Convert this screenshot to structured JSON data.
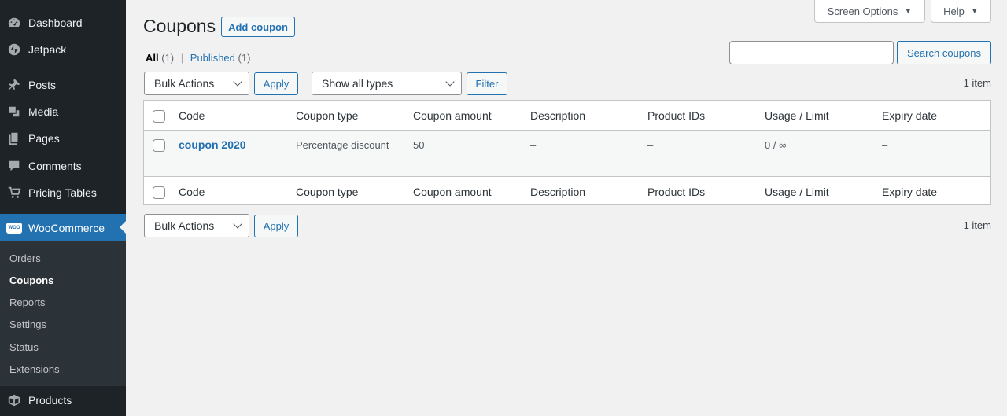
{
  "sidebar": {
    "items": [
      {
        "label": "Dashboard",
        "icon": "dashboard-icon"
      },
      {
        "label": "Jetpack",
        "icon": "jetpack-icon"
      },
      {
        "label": "Posts",
        "icon": "pin-icon"
      },
      {
        "label": "Media",
        "icon": "media-icon"
      },
      {
        "label": "Pages",
        "icon": "pages-icon"
      },
      {
        "label": "Comments",
        "icon": "comments-icon"
      },
      {
        "label": "Pricing Tables",
        "icon": "cart-icon"
      },
      {
        "label": "WooCommerce",
        "icon": "woo-icon"
      },
      {
        "label": "Products",
        "icon": "box-icon"
      }
    ],
    "woo_badge": "WOO",
    "submenu": [
      "Orders",
      "Coupons",
      "Reports",
      "Settings",
      "Status",
      "Extensions"
    ]
  },
  "top_tabs": {
    "screen_options": "Screen Options",
    "help": "Help",
    "caret": "▼"
  },
  "page": {
    "title": "Coupons",
    "add_button": "Add coupon"
  },
  "views": {
    "all": "All",
    "all_count": "(1)",
    "separator": "|",
    "published": "Published",
    "published_count": "(1)"
  },
  "search": {
    "value": "",
    "button": "Search coupons"
  },
  "filters": {
    "bulk_actions": "Bulk Actions",
    "apply": "Apply",
    "type_select": "Show all types",
    "filter_button": "Filter",
    "items_count": "1 item"
  },
  "table": {
    "columns": [
      "Code",
      "Coupon type",
      "Coupon amount",
      "Description",
      "Product IDs",
      "Usage / Limit",
      "Expiry date"
    ],
    "rows": [
      {
        "code": "coupon 2020",
        "type": "Percentage discount",
        "amount": "50",
        "description": "–",
        "product_ids": "–",
        "usage": "0 / ∞",
        "expiry": "–"
      }
    ]
  },
  "colors": {
    "sidebar_bg": "#1d2327",
    "accent": "#2271b1",
    "page_bg": "#f1f1f1"
  }
}
